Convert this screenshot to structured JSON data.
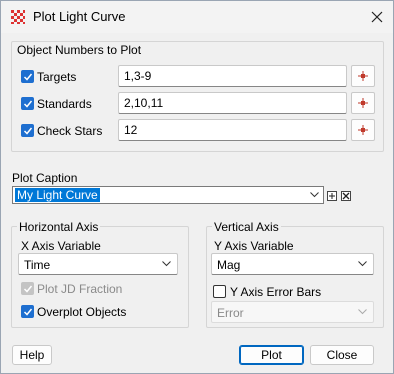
{
  "window": {
    "title": "Plot Light Curve"
  },
  "objects": {
    "group_title": "Object Numbers to Plot",
    "rows": [
      {
        "label": "Targets",
        "value": "1,3-9",
        "checked": true
      },
      {
        "label": "Standards",
        "value": "2,10,11",
        "checked": true
      },
      {
        "label": "Check Stars",
        "value": "12",
        "checked": true
      }
    ]
  },
  "caption": {
    "label": "Plot Caption",
    "value": "My Light Curve"
  },
  "horizontal": {
    "group_title": "Horizontal Axis",
    "var_label": "X Axis Variable",
    "var_value": "Time",
    "jd_label": "Plot JD Fraction",
    "overplot_label": "Overplot Objects"
  },
  "vertical": {
    "group_title": "Vertical Axis",
    "var_label": "Y Axis Variable",
    "var_value": "Mag",
    "errbars_label": "Y Axis Error Bars",
    "error_value": "Error"
  },
  "buttons": {
    "help": "Help",
    "plot": "Plot",
    "close": "Close"
  },
  "colors": {
    "accent": "#1e6fd0",
    "selection": "#0078d7",
    "pick_marker": "#c0392b"
  }
}
